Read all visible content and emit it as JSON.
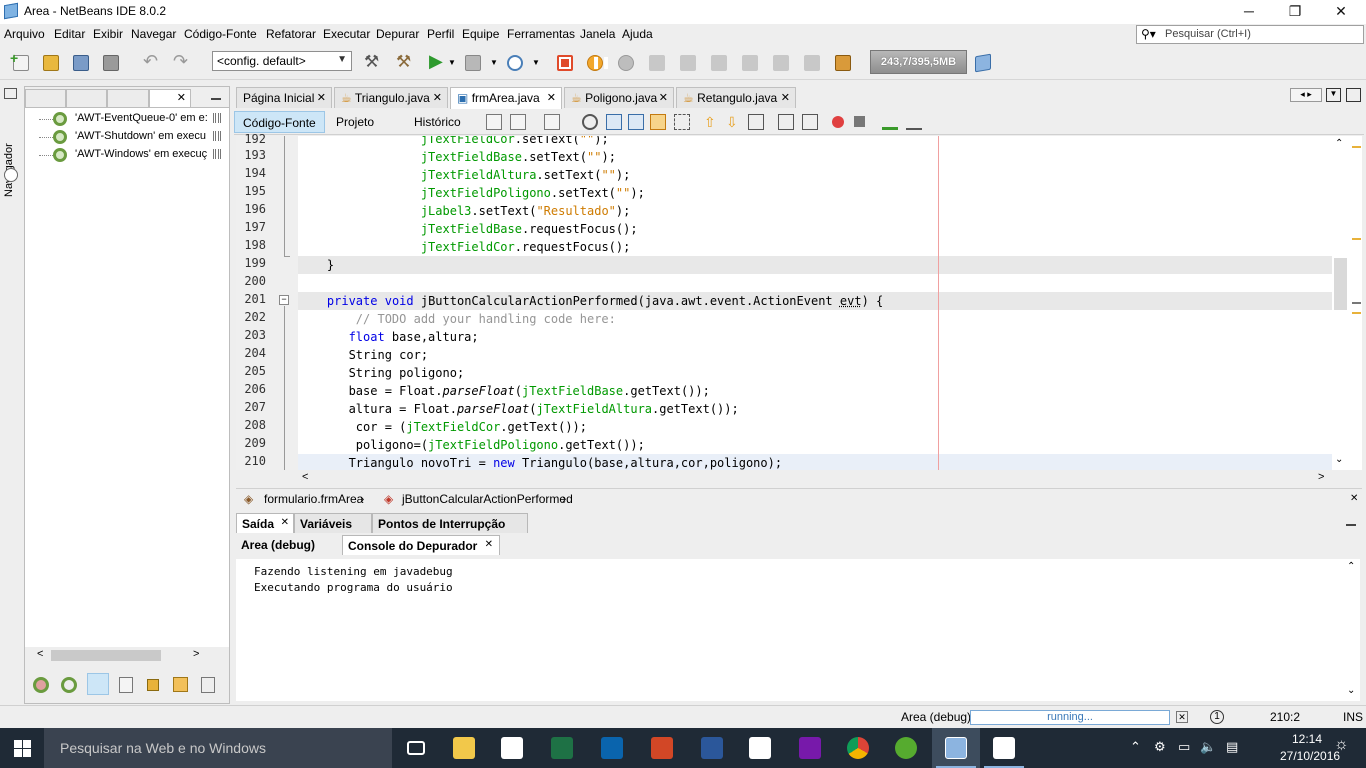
{
  "window": {
    "title": "Area - NetBeans IDE 8.0.2",
    "buttons": {
      "minimize": "─",
      "maximize": "❐",
      "close": "✕"
    }
  },
  "menu": [
    "Arquivo",
    "Editar",
    "Exibir",
    "Navegar",
    "Código-Fonte",
    "Refatorar",
    "Executar",
    "Depurar",
    "Perfil",
    "Equipe",
    "Ferramentas",
    "Janela",
    "Ajuda"
  ],
  "search": {
    "placeholder": "Pesquisar (Ctrl+I)"
  },
  "toolbar": {
    "config": "<config. default>",
    "memory": "243,7/395,5MB"
  },
  "navigator": {
    "strip_label": "Navegador",
    "threads": [
      "'AWT-EventQueue-0' em e:",
      "'AWT-Shutdown' em execu",
      "'AWT-Windows' em execuç"
    ]
  },
  "editor": {
    "tabs": [
      {
        "label": "Página Inicial",
        "active": false
      },
      {
        "label": "Triangulo.java",
        "active": false
      },
      {
        "label": "frmArea.java",
        "active": true
      },
      {
        "label": "Poligono.java",
        "active": false
      },
      {
        "label": "Retangulo.java",
        "active": false
      }
    ],
    "view_tabs": [
      "Código-Fonte",
      "Projeto",
      "Histórico"
    ],
    "line_numbers": [
      "192",
      "193",
      "194",
      "195",
      "196",
      "197",
      "198",
      "199",
      "200",
      "201",
      "202",
      "203",
      "204",
      "205",
      "206",
      "207",
      "208",
      "209",
      "210"
    ],
    "breadcrumb": [
      "formulario.frmArea",
      "jButtonCalcularActionPerformed"
    ]
  },
  "output": {
    "tabs": [
      "Saída",
      "Variáveis",
      "Pontos de Interrupção"
    ],
    "subtabs": [
      "Area (debug)",
      "Console do Depurador"
    ],
    "lines": [
      "Fazendo listening em javadebug",
      "Executando programa do usuário"
    ]
  },
  "status": {
    "task": "Area (debug)",
    "progress": "running...",
    "position": "210:2",
    "mode": "INS"
  },
  "taskbar": {
    "search_placeholder": "Pesquisar na Web e no Windows",
    "time": "12:14",
    "date": "27/10/2016"
  },
  "colors": {
    "keyword": "#0000e6",
    "field": "#009900",
    "string": "#ce7b00",
    "comment": "#969696",
    "taskbar": "#1f2a36"
  }
}
